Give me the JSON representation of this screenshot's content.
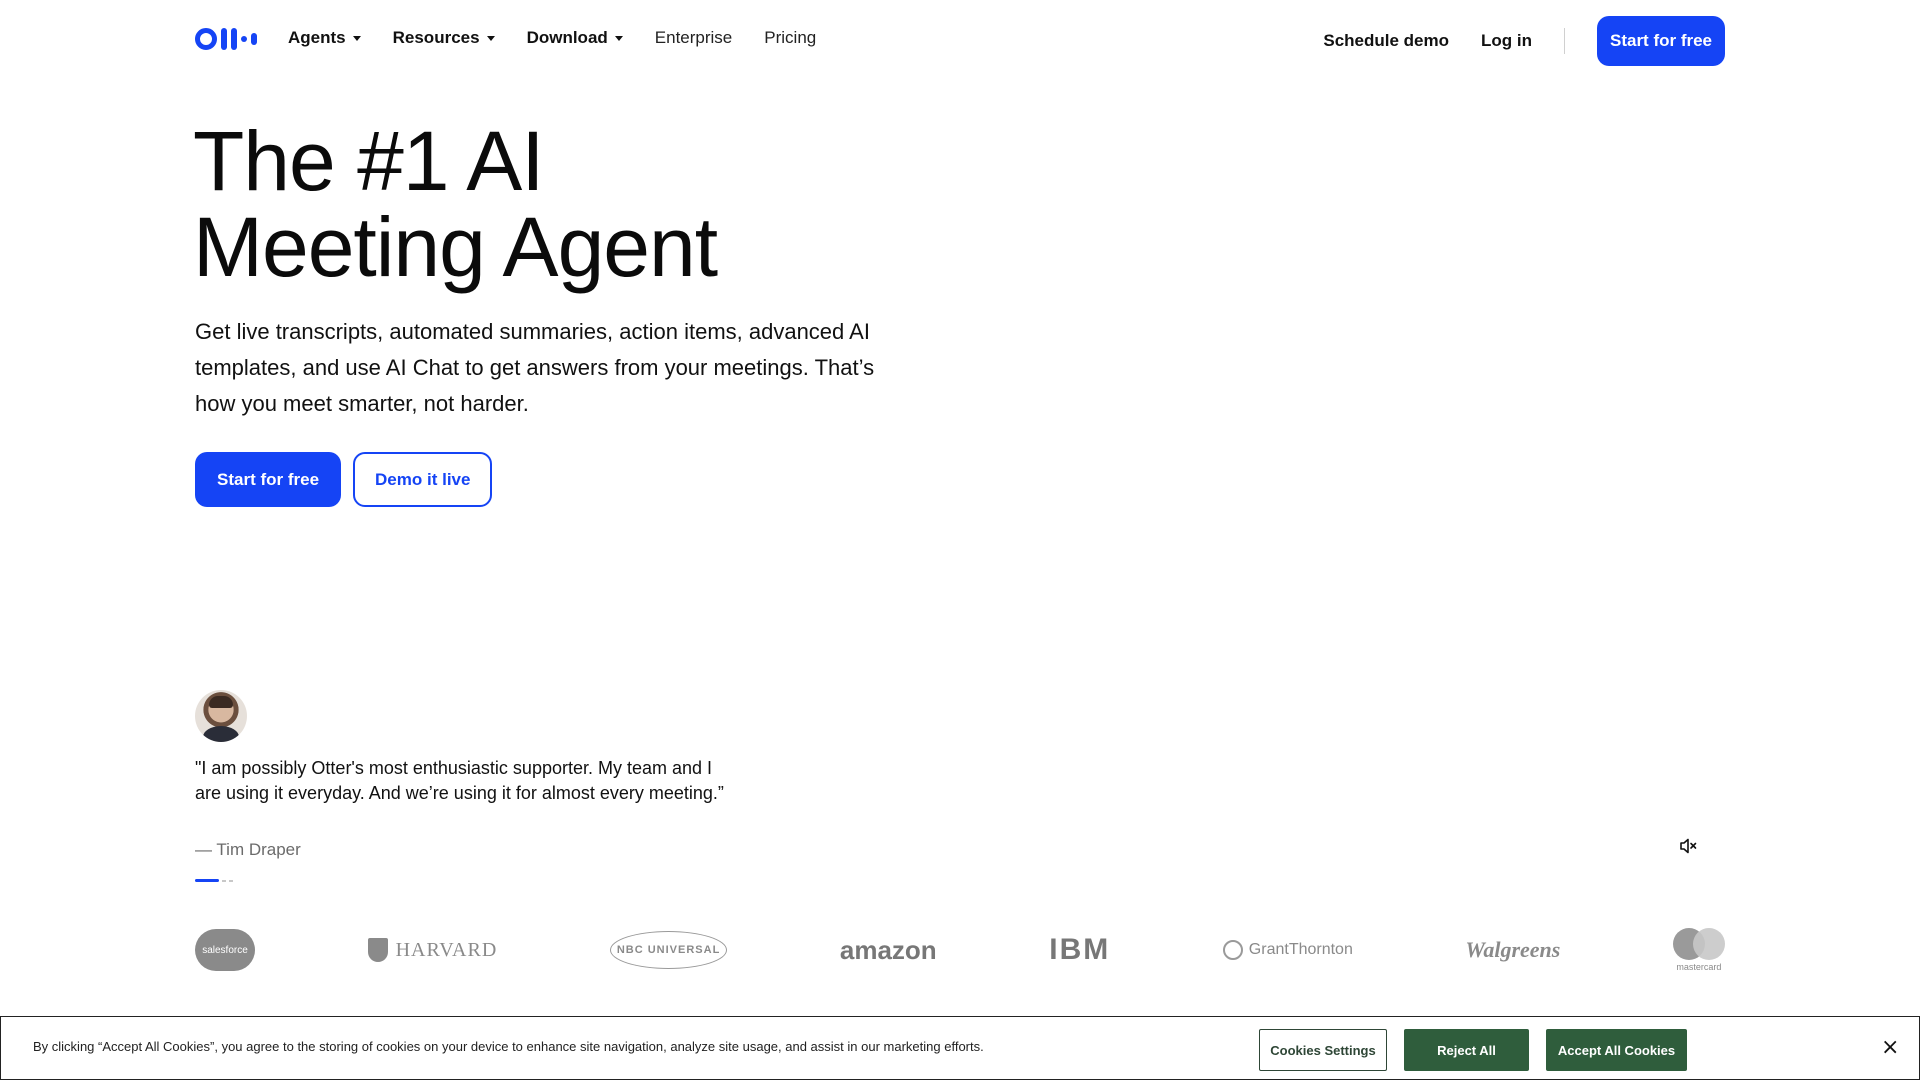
{
  "header": {
    "brand": "Otter.ai",
    "nav": [
      {
        "label": "Agents",
        "has_dropdown": true
      },
      {
        "label": "Resources",
        "has_dropdown": true
      },
      {
        "label": "Download",
        "has_dropdown": true
      },
      {
        "label": "Enterprise",
        "has_dropdown": false
      },
      {
        "label": "Pricing",
        "has_dropdown": false
      }
    ],
    "schedule_demo": "Schedule demo",
    "log_in": "Log in",
    "start_free": "Start for free"
  },
  "hero": {
    "title_line1": "The #1 AI",
    "title_line2": "Meeting Agent",
    "subtitle": "Get live transcripts, automated summaries, action items, advanced AI templates, and use AI Chat to get answers from your meetings. That’s how you meet smarter, not harder.",
    "cta_primary": "Start for free",
    "cta_secondary": "Demo it live"
  },
  "testimonial": {
    "quote": "\"I am possibly Otter's most enthusiastic supporter. My team and I are using it everyday. And we’re using it for almost every meeting.”",
    "author": "— Tim Draper"
  },
  "logos": [
    {
      "name": "salesforce",
      "text": "salesforce"
    },
    {
      "name": "harvard",
      "text": "HARVARD"
    },
    {
      "name": "nbcuniversal",
      "text": "NBC UNIVERSAL"
    },
    {
      "name": "amazon",
      "text": "amazon"
    },
    {
      "name": "ibm",
      "text": "IBM"
    },
    {
      "name": "grant-thornton",
      "text": "GrantThornton"
    },
    {
      "name": "walgreens",
      "text": "Walgreens"
    },
    {
      "name": "mastercard",
      "text": "mastercard"
    }
  ],
  "cookie": {
    "text": "By clicking “Accept All Cookies”, you agree to the storing of cookies on your device to enhance site navigation, analyze site usage, and assist in our marketing efforts.",
    "settings": "Cookies Settings",
    "reject": "Reject All",
    "accept": "Accept All Cookies",
    "close": "×"
  },
  "colors": {
    "brand_blue": "#1544f5",
    "cookie_green": "#2f5d3c"
  }
}
